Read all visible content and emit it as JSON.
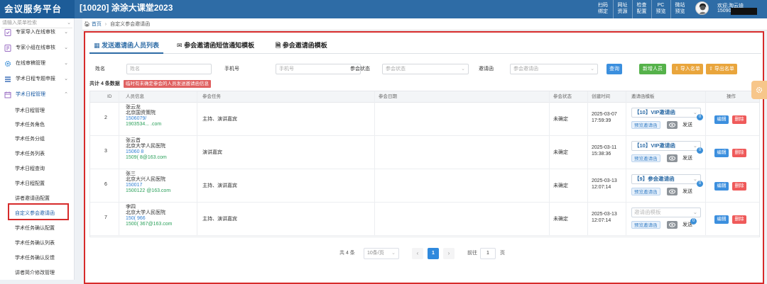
{
  "app": {
    "logo": "会议服务平台",
    "project_title": "[10020] 涂涂大课堂2023",
    "top_buttons": [
      {
        "line1": "扫码",
        "line2": "绑定"
      },
      {
        "line1": "网址",
        "line2": "资源"
      },
      {
        "line1": "检查",
        "line2": "配置"
      },
      {
        "line1": "PC",
        "line2": "预览"
      },
      {
        "line1": "微站",
        "line2": "预览"
      }
    ],
    "user": {
      "welcome": "欢迎,淘云迪",
      "phone": "15090"
    }
  },
  "sidebar": {
    "search_placeholder": "请输入菜单检索",
    "items": [
      {
        "label": "专家导入在线审核",
        "icon": "doc-check-icon"
      },
      {
        "label": "专家小组在线审核",
        "icon": "doc-edit-icon"
      },
      {
        "label": "在线审稿管理",
        "icon": "gear-icon"
      },
      {
        "label": "学术日程专题申报",
        "icon": "list-icon"
      },
      {
        "label": "学术日程管理",
        "icon": "calendar-icon"
      }
    ],
    "subitems": [
      "学术日程管理",
      "学术任务角色",
      "学术任务分组",
      "学术任务列表",
      "学术日程查询",
      "学术日程配置",
      "讲者邀请函配置",
      "自定义参会邀请函",
      "学术任务确认配置",
      "学术任务确认列表",
      "学术任务确认反馈",
      "讲者简介修改管理"
    ]
  },
  "breadcrumb": {
    "home": "首页",
    "current": "自定义参会邀请函"
  },
  "tabs": [
    {
      "label": "发送邀请函人员列表",
      "icon": "grid-icon"
    },
    {
      "label": "参会邀请函短信通知模板",
      "icon": "mail-icon"
    },
    {
      "label": "参会邀请函模板",
      "icon": "file-icon"
    }
  ],
  "filters": {
    "name_label": "姓名",
    "name_placeholder": "姓名",
    "phone_label": "手机号",
    "phone_placeholder": "手机号",
    "status_label": "参会状态",
    "status_placeholder": "参会状态",
    "template_label": "邀请函",
    "template_placeholder": "参会邀请函",
    "search_btn": "查询",
    "add_btn": "新增人员",
    "import_btn": "导入名单",
    "export_btn": "导出名单"
  },
  "summary": {
    "total": "共计 4 条数据",
    "warning": "临时有未确定参会的人员发送邀请函信息"
  },
  "table": {
    "headers": [
      "ID",
      "人员信息",
      "参会任务",
      "参会日期",
      "参会状态",
      "创建时间",
      "邀请函模板",
      "操作"
    ],
    "preview_label": "预览邀请函",
    "send_label": "发送",
    "edit_label": "编辑",
    "delete_label": "删除",
    "template_placeholder": "邀请函模板",
    "rows": [
      {
        "id": "2",
        "name": "张云龙",
        "org": "北京国资策院",
        "phone": "1506079/",
        "email": "1903534...  .com",
        "task": "主持、演讲嘉宾",
        "date": "",
        "status": "未确定",
        "created_date": "2025-03-07",
        "created_time": "17:59:39",
        "template": "【10】VIP邀请函",
        "send_count": "0"
      },
      {
        "id": "3",
        "name": "张云首",
        "org": "北京大学人民医院",
        "phone": "15060     8",
        "email": "1509(      8@163.com",
        "task": "演讲嘉宾",
        "date": "",
        "status": "未确定",
        "created_date": "2025-03-11",
        "created_time": "15:38:36",
        "template": "【10】VIP邀请函",
        "send_count": "0"
      },
      {
        "id": "6",
        "name": "张三",
        "org": "北京大兴人民医院",
        "phone": "150017",
        "email": "1500122      @163.com",
        "task": "主持、演讲嘉宾",
        "date": "",
        "status": "未确定",
        "created_date": "2025-03-13",
        "created_time": "12:07:14",
        "template": "【9】参会邀请函",
        "send_count": "0"
      },
      {
        "id": "7",
        "name": "李四",
        "org": "北京大学人民医院",
        "phone": "150(      966",
        "email": "1500(      367@163.com",
        "task": "主持、演讲嘉宾",
        "date": "",
        "status": "未确定",
        "created_date": "2025-03-13",
        "created_time": "12:07:14",
        "template": "",
        "send_count": "0"
      }
    ]
  },
  "pagination": {
    "total": "共 4 条",
    "page_size": "10条/页",
    "current": "1",
    "goto_label": "前往",
    "goto_value": "1",
    "page_suffix": "页"
  },
  "colors": {
    "header_bg": "#2e6ca6",
    "logo_bg": "#1d5c98",
    "highlight": "#d62b2b",
    "accent": "#2f89dd"
  }
}
